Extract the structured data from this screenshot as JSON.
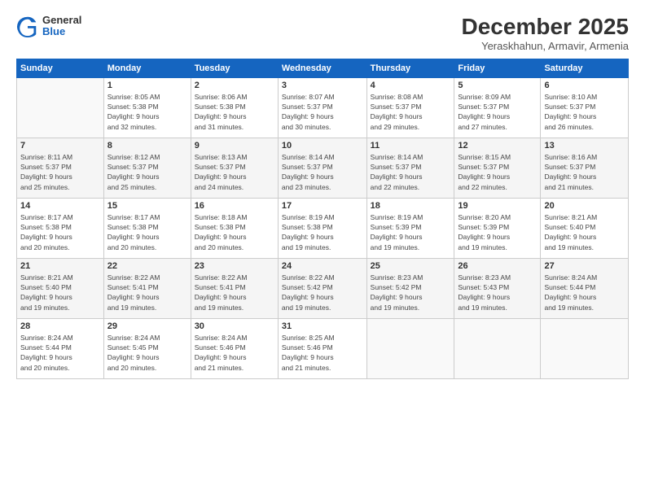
{
  "header": {
    "logo_general": "General",
    "logo_blue": "Blue",
    "month_title": "December 2025",
    "subtitle": "Yeraskhahun, Armavir, Armenia"
  },
  "columns": [
    "Sunday",
    "Monday",
    "Tuesday",
    "Wednesday",
    "Thursday",
    "Friday",
    "Saturday"
  ],
  "weeks": [
    [
      {
        "day": "",
        "info": ""
      },
      {
        "day": "1",
        "info": "Sunrise: 8:05 AM\nSunset: 5:38 PM\nDaylight: 9 hours\nand 32 minutes."
      },
      {
        "day": "2",
        "info": "Sunrise: 8:06 AM\nSunset: 5:38 PM\nDaylight: 9 hours\nand 31 minutes."
      },
      {
        "day": "3",
        "info": "Sunrise: 8:07 AM\nSunset: 5:37 PM\nDaylight: 9 hours\nand 30 minutes."
      },
      {
        "day": "4",
        "info": "Sunrise: 8:08 AM\nSunset: 5:37 PM\nDaylight: 9 hours\nand 29 minutes."
      },
      {
        "day": "5",
        "info": "Sunrise: 8:09 AM\nSunset: 5:37 PM\nDaylight: 9 hours\nand 27 minutes."
      },
      {
        "day": "6",
        "info": "Sunrise: 8:10 AM\nSunset: 5:37 PM\nDaylight: 9 hours\nand 26 minutes."
      }
    ],
    [
      {
        "day": "7",
        "info": "Sunrise: 8:11 AM\nSunset: 5:37 PM\nDaylight: 9 hours\nand 25 minutes."
      },
      {
        "day": "8",
        "info": "Sunrise: 8:12 AM\nSunset: 5:37 PM\nDaylight: 9 hours\nand 25 minutes."
      },
      {
        "day": "9",
        "info": "Sunrise: 8:13 AM\nSunset: 5:37 PM\nDaylight: 9 hours\nand 24 minutes."
      },
      {
        "day": "10",
        "info": "Sunrise: 8:14 AM\nSunset: 5:37 PM\nDaylight: 9 hours\nand 23 minutes."
      },
      {
        "day": "11",
        "info": "Sunrise: 8:14 AM\nSunset: 5:37 PM\nDaylight: 9 hours\nand 22 minutes."
      },
      {
        "day": "12",
        "info": "Sunrise: 8:15 AM\nSunset: 5:37 PM\nDaylight: 9 hours\nand 22 minutes."
      },
      {
        "day": "13",
        "info": "Sunrise: 8:16 AM\nSunset: 5:37 PM\nDaylight: 9 hours\nand 21 minutes."
      }
    ],
    [
      {
        "day": "14",
        "info": "Sunrise: 8:17 AM\nSunset: 5:38 PM\nDaylight: 9 hours\nand 20 minutes."
      },
      {
        "day": "15",
        "info": "Sunrise: 8:17 AM\nSunset: 5:38 PM\nDaylight: 9 hours\nand 20 minutes."
      },
      {
        "day": "16",
        "info": "Sunrise: 8:18 AM\nSunset: 5:38 PM\nDaylight: 9 hours\nand 20 minutes."
      },
      {
        "day": "17",
        "info": "Sunrise: 8:19 AM\nSunset: 5:38 PM\nDaylight: 9 hours\nand 19 minutes."
      },
      {
        "day": "18",
        "info": "Sunrise: 8:19 AM\nSunset: 5:39 PM\nDaylight: 9 hours\nand 19 minutes."
      },
      {
        "day": "19",
        "info": "Sunrise: 8:20 AM\nSunset: 5:39 PM\nDaylight: 9 hours\nand 19 minutes."
      },
      {
        "day": "20",
        "info": "Sunrise: 8:21 AM\nSunset: 5:40 PM\nDaylight: 9 hours\nand 19 minutes."
      }
    ],
    [
      {
        "day": "21",
        "info": "Sunrise: 8:21 AM\nSunset: 5:40 PM\nDaylight: 9 hours\nand 19 minutes."
      },
      {
        "day": "22",
        "info": "Sunrise: 8:22 AM\nSunset: 5:41 PM\nDaylight: 9 hours\nand 19 minutes."
      },
      {
        "day": "23",
        "info": "Sunrise: 8:22 AM\nSunset: 5:41 PM\nDaylight: 9 hours\nand 19 minutes."
      },
      {
        "day": "24",
        "info": "Sunrise: 8:22 AM\nSunset: 5:42 PM\nDaylight: 9 hours\nand 19 minutes."
      },
      {
        "day": "25",
        "info": "Sunrise: 8:23 AM\nSunset: 5:42 PM\nDaylight: 9 hours\nand 19 minutes."
      },
      {
        "day": "26",
        "info": "Sunrise: 8:23 AM\nSunset: 5:43 PM\nDaylight: 9 hours\nand 19 minutes."
      },
      {
        "day": "27",
        "info": "Sunrise: 8:24 AM\nSunset: 5:44 PM\nDaylight: 9 hours\nand 19 minutes."
      }
    ],
    [
      {
        "day": "28",
        "info": "Sunrise: 8:24 AM\nSunset: 5:44 PM\nDaylight: 9 hours\nand 20 minutes."
      },
      {
        "day": "29",
        "info": "Sunrise: 8:24 AM\nSunset: 5:45 PM\nDaylight: 9 hours\nand 20 minutes."
      },
      {
        "day": "30",
        "info": "Sunrise: 8:24 AM\nSunset: 5:46 PM\nDaylight: 9 hours\nand 21 minutes."
      },
      {
        "day": "31",
        "info": "Sunrise: 8:25 AM\nSunset: 5:46 PM\nDaylight: 9 hours\nand 21 minutes."
      },
      {
        "day": "",
        "info": ""
      },
      {
        "day": "",
        "info": ""
      },
      {
        "day": "",
        "info": ""
      }
    ]
  ]
}
